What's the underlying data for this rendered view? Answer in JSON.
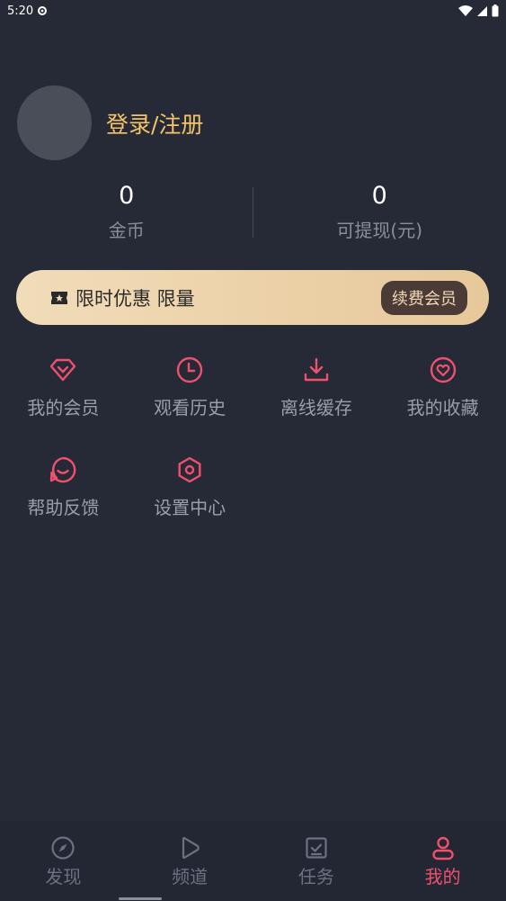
{
  "status": {
    "time": "5:20"
  },
  "profile": {
    "login_label": "登录/注册"
  },
  "stats": [
    {
      "value": "0",
      "label": "金币"
    },
    {
      "value": "0",
      "label": "可提现(元)"
    }
  ],
  "promo": {
    "text": "限时优惠 限量",
    "button": "续费会员"
  },
  "grid": [
    {
      "label": "我的会员",
      "icon": "vip-diamond-icon"
    },
    {
      "label": "观看历史",
      "icon": "clock-icon"
    },
    {
      "label": "离线缓存",
      "icon": "download-icon"
    },
    {
      "label": "我的收藏",
      "icon": "heart-icon"
    },
    {
      "label": "帮助反馈",
      "icon": "feedback-icon"
    },
    {
      "label": "设置中心",
      "icon": "settings-icon"
    }
  ],
  "tabs": [
    {
      "label": "发现",
      "icon": "compass-icon"
    },
    {
      "label": "频道",
      "icon": "play-icon"
    },
    {
      "label": "任务",
      "icon": "task-icon"
    },
    {
      "label": "我的",
      "icon": "profile-icon",
      "active": true
    }
  ],
  "colors": {
    "accent": "#f0506e",
    "gold": "#f3c46b",
    "background": "#262a36"
  }
}
